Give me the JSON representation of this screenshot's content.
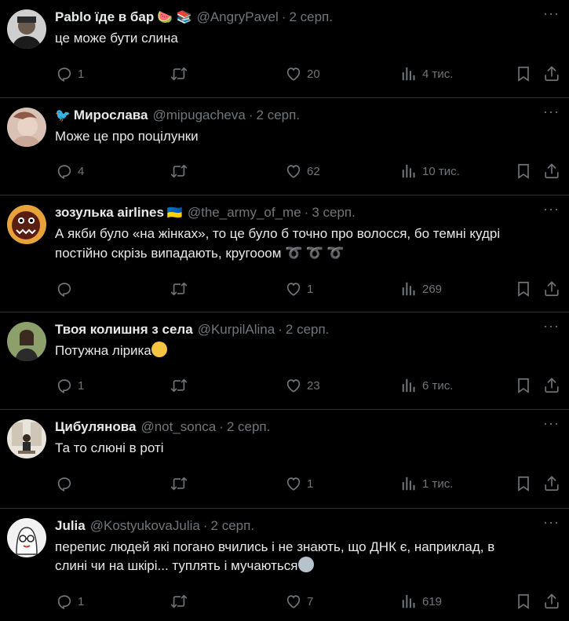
{
  "tweets": [
    {
      "name": "Pablo їде в бар",
      "badges": "🍉 📚",
      "handle": "@AngryPavel",
      "date": "2 серп.",
      "text": "це може бути слина",
      "replies": "1",
      "likes": "20",
      "views": "4 тис."
    },
    {
      "name": "Мирослава",
      "badges": "🐦",
      "handle": "@mipugacheva",
      "date": "2 серп.",
      "text": "Може це про поцілунки",
      "replies": "4",
      "likes": "62",
      "views": "10 тис."
    },
    {
      "name": "зозулька airlines",
      "badges": "🇺🇦",
      "handle": "@the_army_of_me",
      "date": "3 серп.",
      "text_line1": "А якби було «на жінках», то це було б точно про волосся, бо темні кудрі",
      "text_line2": "постійно скрізь випадають, кругооом",
      "loops": "➰➰➰",
      "replies": "",
      "likes": "1",
      "views": "269"
    },
    {
      "name": "Твоя колишня з села",
      "handle": "@KurpilAlina",
      "date": "2 серп.",
      "text": "Потужна лірика",
      "replies": "1",
      "likes": "23",
      "views": "6 тис."
    },
    {
      "name": "Цибулянова",
      "handle": "@not_sonca",
      "date": "2 серп.",
      "text": "Та то слюні в роті",
      "replies": "",
      "likes": "1",
      "views": "1 тис."
    },
    {
      "name": "Julia",
      "handle": "@KostyukovaJulia",
      "date": "2 серп.",
      "text_line1": "перепис людей які погано вчились і не знають, що ДНК є, наприклад, в",
      "text_line2": "слині чи на шкірі... туплять і мучаються",
      "replies": "1",
      "likes": "7",
      "views": "619"
    }
  ],
  "dot": "·",
  "more": "···",
  "colors": {
    "background": "#000000",
    "text": "#e7e9ea",
    "muted": "#71767b",
    "border": "#2f3336"
  },
  "icons": [
    "reply-icon",
    "retweet-icon",
    "like-icon",
    "views-icon",
    "bookmark-icon",
    "share-icon",
    "more-icon"
  ]
}
